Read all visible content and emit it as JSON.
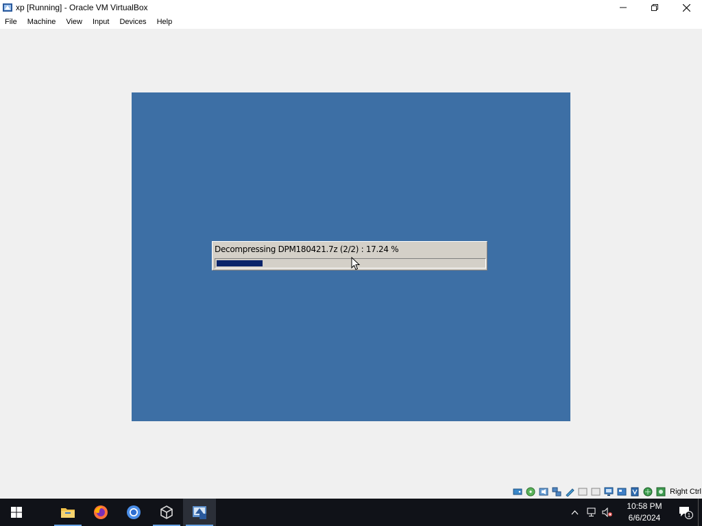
{
  "window": {
    "title": "xp [Running] - Oracle VM VirtualBox",
    "controls": {
      "minimize": "minimize-icon",
      "restore": "restore-icon",
      "close": "close-icon"
    }
  },
  "menu": [
    "File",
    "Machine",
    "View",
    "Input",
    "Devices",
    "Help"
  ],
  "vm": {
    "background_color": "#3d6fa5",
    "progress_dialog": {
      "text": "Decompressing DPM180421.7z  (2/2) : 17.24 %",
      "percent": 17.24,
      "fill_color": "#0a246a"
    }
  },
  "statusbar": {
    "icons": [
      "hard-disk-icon",
      "optical-drive-icon",
      "audio-icon",
      "network-icon",
      "usb-icon",
      "shared-folders-icon",
      "display-icon",
      "video-capture-icon",
      "recording-icon",
      "cpu-icon",
      "mouse-integration-icon",
      "keyboard-icon",
      "guest-additions-icon"
    ],
    "host_key": "Right Ctrl"
  },
  "taskbar": {
    "apps": [
      "start-icon",
      "file-explorer-icon",
      "firefox-icon",
      "chrome-icon",
      "virtualbox-manager-icon",
      "virtualbox-vm-icon"
    ],
    "tray": {
      "time": "10:58 PM",
      "date": "6/6/2024",
      "notification_count": "1"
    }
  }
}
